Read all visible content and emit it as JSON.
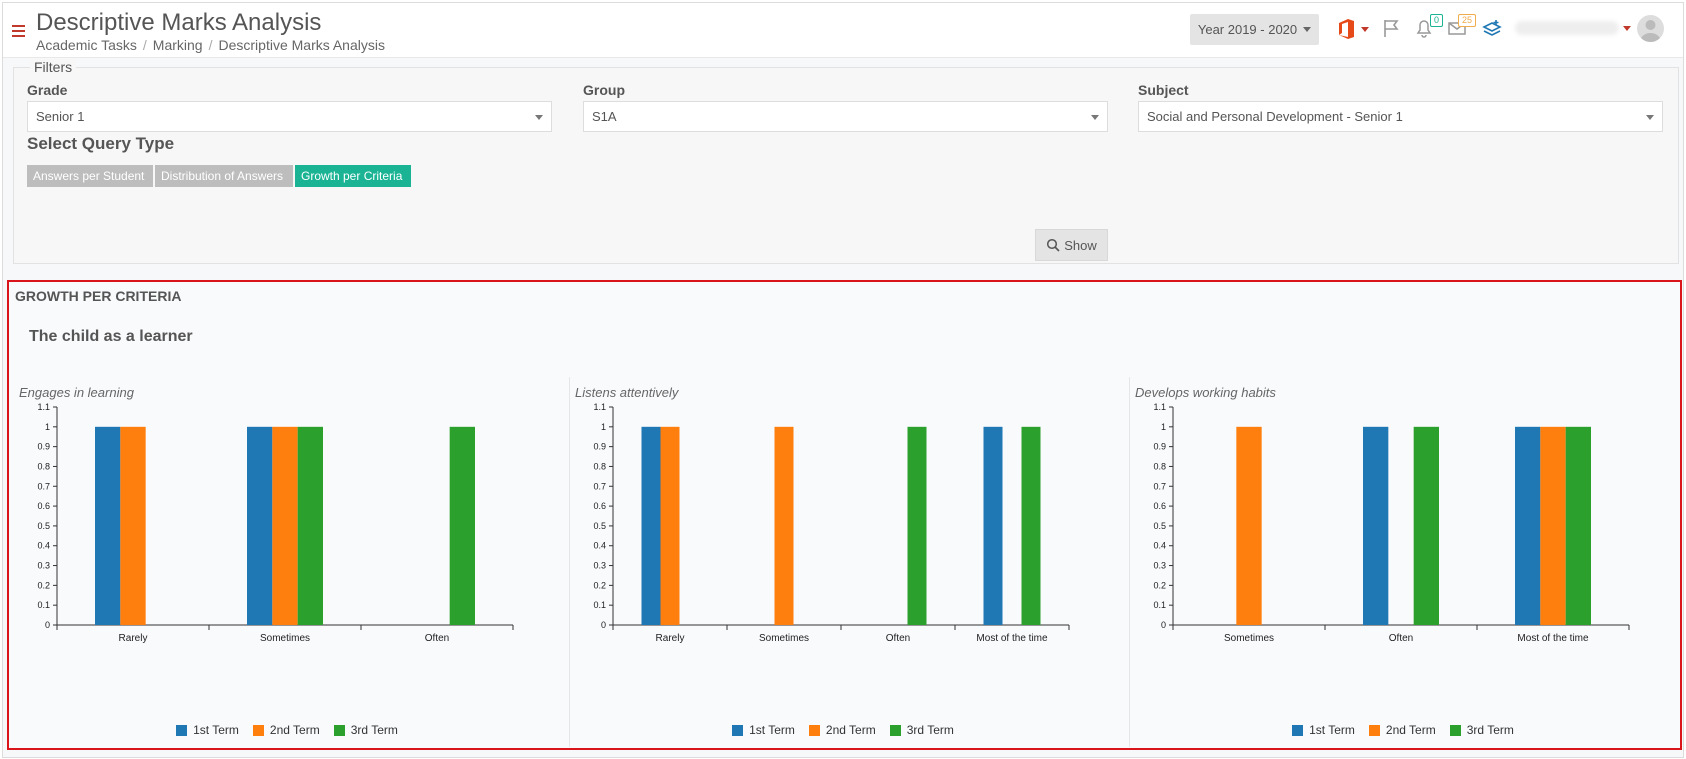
{
  "header": {
    "title": "Descriptive Marks Analysis",
    "breadcrumb": [
      "Academic Tasks",
      "Marking",
      "Descriptive Marks Analysis"
    ],
    "year_label": "Year 2019 - 2020",
    "notifications_count": "0",
    "messages_count": "25"
  },
  "filters": {
    "legend": "Filters",
    "grade": {
      "label": "Grade",
      "value": "Senior 1"
    },
    "group": {
      "label": "Group",
      "value": "S1A"
    },
    "subject": {
      "label": "Subject",
      "value": "Social and Personal Development - Senior 1"
    },
    "query_type_title": "Select Query Type",
    "query_types": [
      {
        "label": "Answers per Student",
        "active": false
      },
      {
        "label": "Distribution of Answers",
        "active": false
      },
      {
        "label": "Growth per Criteria",
        "active": true
      }
    ],
    "show_label": "Show"
  },
  "results": {
    "title": "GROWTH PER CRITERIA",
    "section": "The child as a learner"
  },
  "colors": {
    "term1": "#1f77b4",
    "term2": "#ff7f0e",
    "term3": "#2ca02c",
    "active": "#1ab394",
    "inactive": "#bdbdbd"
  },
  "chart_data": [
    {
      "type": "bar",
      "title": "Engages in learning",
      "categories": [
        "Rarely",
        "Sometimes",
        "Often"
      ],
      "ylim": [
        0,
        1.1
      ],
      "yticks": [
        "0",
        "0.1",
        "0.2",
        "0.3",
        "0.4",
        "0.5",
        "0.6",
        "0.7",
        "0.8",
        "0.9",
        "1",
        "1.1"
      ],
      "series": [
        {
          "name": "1st Term",
          "values": [
            1,
            1,
            0
          ]
        },
        {
          "name": "2nd Term",
          "values": [
            1,
            1,
            0
          ]
        },
        {
          "name": "3rd Term",
          "values": [
            0,
            1,
            1
          ]
        }
      ]
    },
    {
      "type": "bar",
      "title": "Listens attentively",
      "categories": [
        "Rarely",
        "Sometimes",
        "Often",
        "Most of the time"
      ],
      "ylim": [
        0,
        1.1
      ],
      "yticks": [
        "0",
        "0.1",
        "0.2",
        "0.3",
        "0.4",
        "0.5",
        "0.6",
        "0.7",
        "0.8",
        "0.9",
        "1",
        "1.1"
      ],
      "series": [
        {
          "name": "1st Term",
          "values": [
            1,
            0,
            0,
            1
          ]
        },
        {
          "name": "2nd Term",
          "values": [
            1,
            1,
            0,
            0
          ]
        },
        {
          "name": "3rd Term",
          "values": [
            0,
            0,
            1,
            1
          ]
        }
      ]
    },
    {
      "type": "bar",
      "title": "Develops working habits",
      "categories": [
        "Sometimes",
        "Often",
        "Most of the time"
      ],
      "ylim": [
        0,
        1.1
      ],
      "yticks": [
        "0",
        "0.1",
        "0.2",
        "0.3",
        "0.4",
        "0.5",
        "0.6",
        "0.7",
        "0.8",
        "0.9",
        "1",
        "1.1"
      ],
      "series": [
        {
          "name": "1st Term",
          "values": [
            0,
            1,
            1
          ]
        },
        {
          "name": "2nd Term",
          "values": [
            1,
            0,
            1
          ]
        },
        {
          "name": "3rd Term",
          "values": [
            0,
            1,
            1
          ]
        }
      ]
    }
  ]
}
